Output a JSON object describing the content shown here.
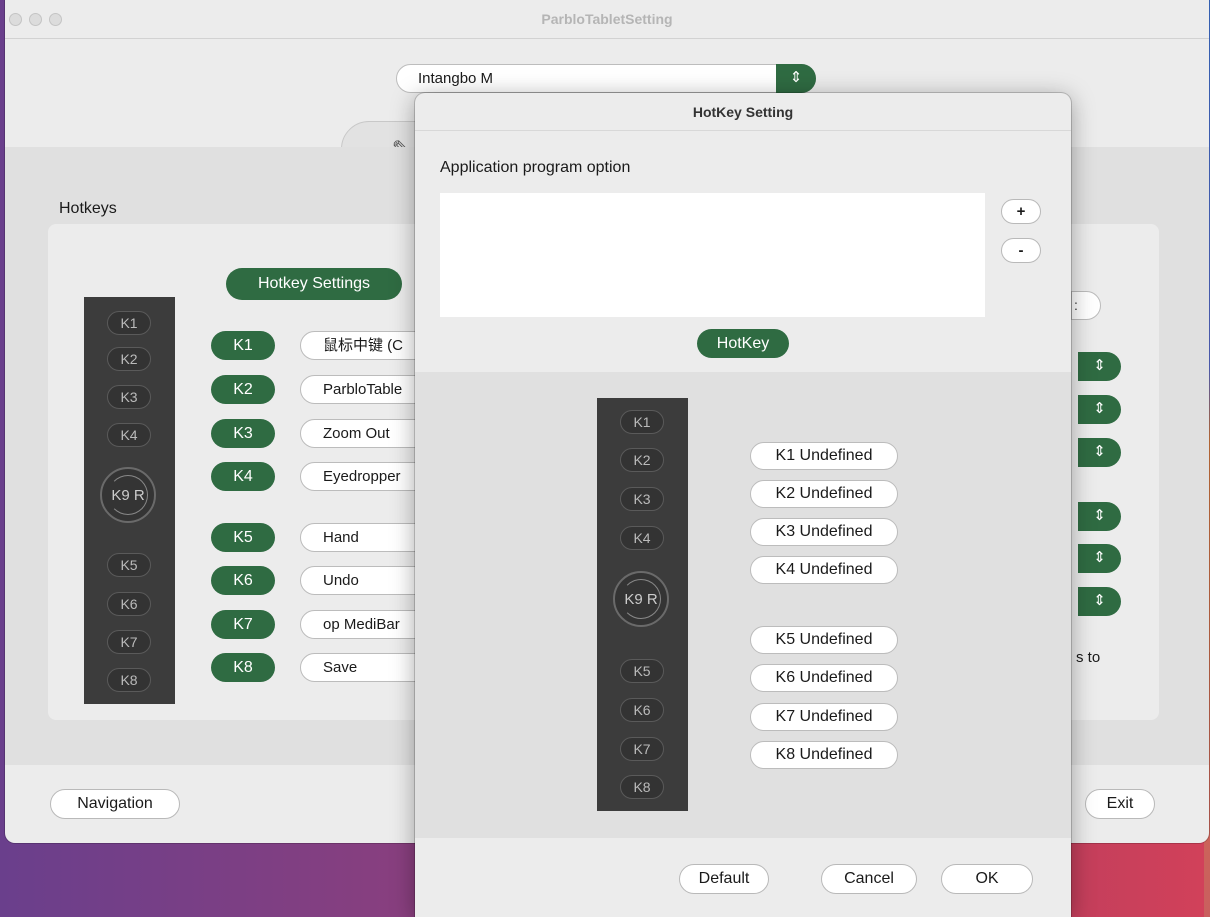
{
  "window": {
    "title": "ParbloTabletSetting"
  },
  "device": {
    "selected": "Intangbo M",
    "stepper_glyph": "⇕"
  },
  "pen_tab_glyph": "✎",
  "section": {
    "title": "Hotkeys",
    "settings_label": "Hotkey Settings"
  },
  "tablet_keys": [
    "K1",
    "K2",
    "K3",
    "K4",
    "K5",
    "K6",
    "K7",
    "K8"
  ],
  "dial_label": "K9 R",
  "hotkeys": [
    {
      "key": "K1",
      "action": "鼠标中键 (C"
    },
    {
      "key": "K2",
      "action": "ParbloTable"
    },
    {
      "key": "K3",
      "action": "Zoom Out"
    },
    {
      "key": "K4",
      "action": "Eyedropper"
    },
    {
      "key": "K5",
      "action": "Hand"
    },
    {
      "key": "K6",
      "action": "Undo"
    },
    {
      "key": "K7",
      "action": "op MediBar"
    },
    {
      "key": "K8",
      "action": "Save"
    }
  ],
  "right_fragment": {
    "pill_text": ":",
    "tail_text": "s to",
    "stepper_glyph": "⇕"
  },
  "footer": {
    "navigation_label": "Navigation",
    "exit_label": "Exit"
  },
  "dialog": {
    "title": "HotKey Setting",
    "app_option_label": "Application program option",
    "add_label": "+",
    "remove_label": "-",
    "hotkey_label": "HotKey",
    "keys": [
      "K1",
      "K2",
      "K3",
      "K4",
      "K5",
      "K6",
      "K7",
      "K8"
    ],
    "dial_label": "K9 R",
    "undefined_buttons": [
      "K1 Undefined",
      "K2 Undefined",
      "K3 Undefined",
      "K4 Undefined",
      "K5 Undefined",
      "K6 Undefined",
      "K7 Undefined",
      "K8 Undefined"
    ],
    "default_label": "Default",
    "cancel_label": "Cancel",
    "ok_label": "OK"
  },
  "colors": {
    "accent_green": "#2f6b42",
    "tablet_dark": "#3c3c3c"
  }
}
